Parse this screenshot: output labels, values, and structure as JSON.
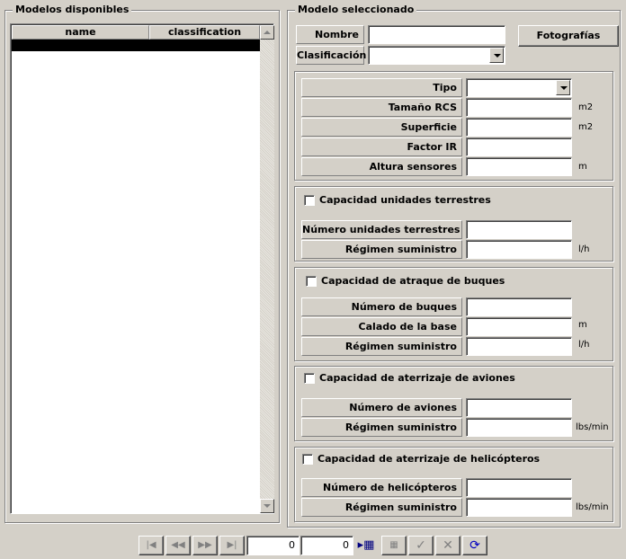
{
  "left": {
    "title": "Modelos disponibles",
    "columns": [
      "name",
      "classification"
    ]
  },
  "right": {
    "title": "Modelo seleccionado",
    "nombre_label": "Nombre",
    "clasificacion_label": "Clasificación",
    "fotografias_button": "Fotografías",
    "props": {
      "tipo": "Tipo",
      "tamano": "Tamaño RCS",
      "tamano_unit": "m2",
      "superficie": "Superficie",
      "superficie_unit": "m2",
      "factor": "Factor IR",
      "altura": "Altura sensores",
      "altura_unit": "m"
    },
    "terrestres": {
      "checkbox": "Capacidad unidades terrestres",
      "numero": "Número unidades terrestres",
      "regimen": "Régimen suministro",
      "regimen_unit": "l/h"
    },
    "buques": {
      "checkbox": "Capacidad de atraque de buques",
      "numero": "Número de buques",
      "calado": "Calado de la base",
      "calado_unit": "m",
      "regimen": "Régimen suministro",
      "regimen_unit": "l/h"
    },
    "aviones": {
      "checkbox": "Capacidad de aterrizaje de aviones",
      "numero": "Número de aviones",
      "regimen": "Régimen suministro",
      "regimen_unit": "lbs/min"
    },
    "helicopteros": {
      "checkbox": "Capacidad de aterrizaje de helicópteros",
      "numero": "Número de helicópteros",
      "regimen": "Régimen suministro",
      "regimen_unit": "lbs/min"
    }
  },
  "navigator": {
    "record_value": "0",
    "count_value": "0"
  }
}
